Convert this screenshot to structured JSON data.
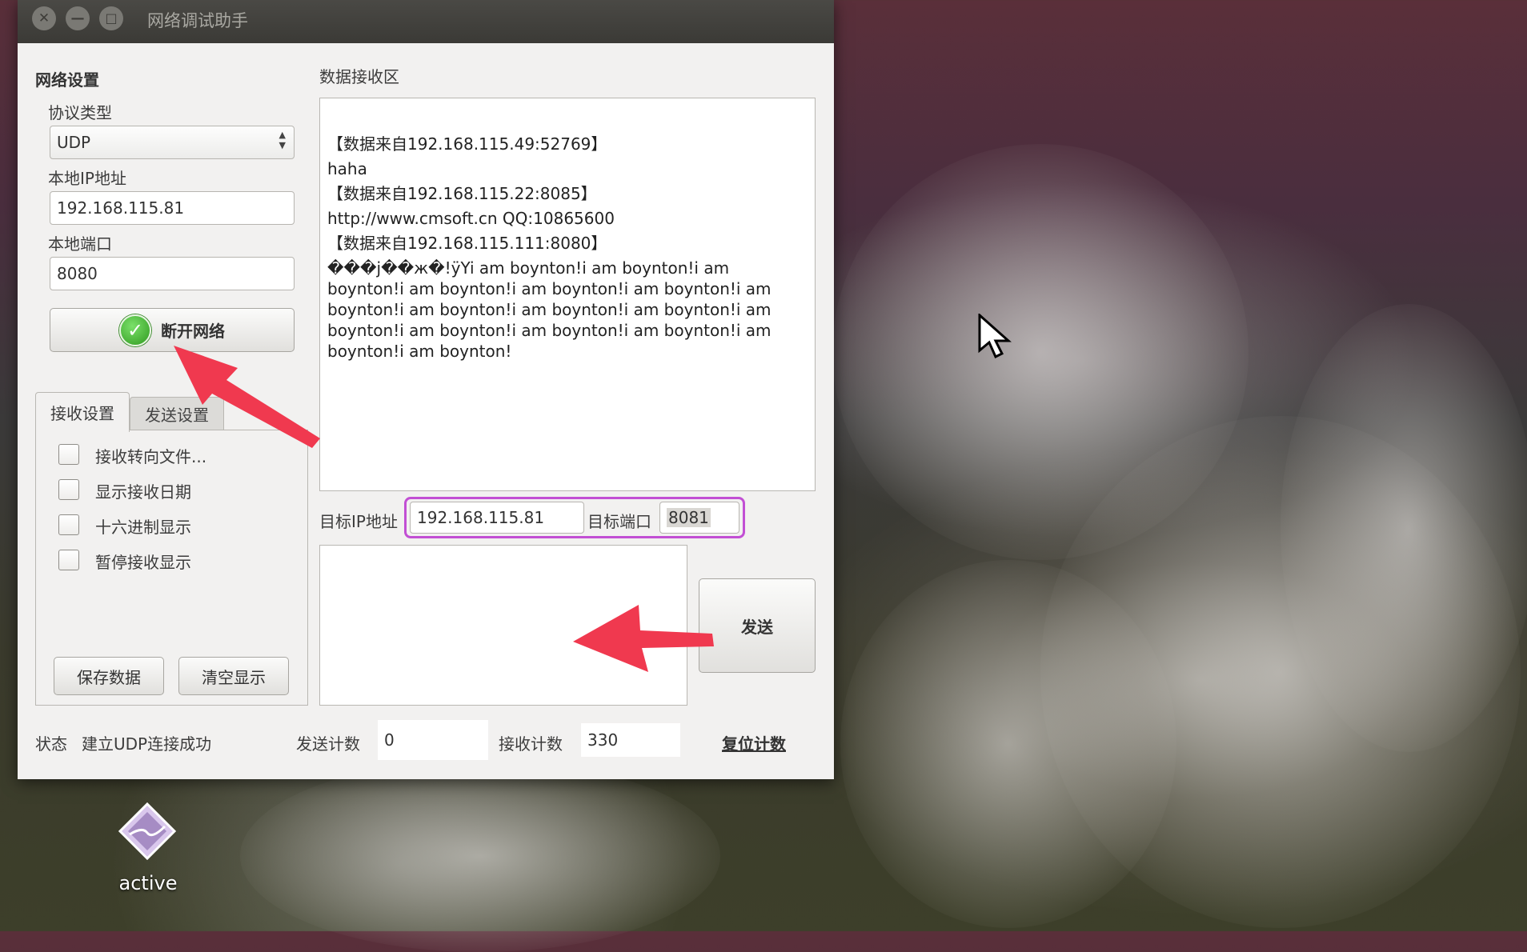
{
  "window": {
    "title": "网络调试助手",
    "close_glyph": "✕",
    "minimize_glyph": "—",
    "maximize_glyph": "□"
  },
  "network_settings": {
    "heading": "网络设置",
    "protocol_label": "协议类型",
    "protocol_value": "UDP",
    "local_ip_label": "本地IP地址",
    "local_ip_value": "192.168.115.81",
    "local_port_label": "本地端口",
    "local_port_value": "8080",
    "connect_button_label": "断开网络"
  },
  "tabs": [
    {
      "label": "接收设置",
      "active": true
    },
    {
      "label": "发送设置",
      "active": false
    }
  ],
  "receive_settings": {
    "options": [
      {
        "label": "接收转向文件...",
        "checked": false
      },
      {
        "label": "显示接收日期",
        "checked": false
      },
      {
        "label": "十六进制显示",
        "checked": false
      },
      {
        "label": "暂停接收显示",
        "checked": false
      }
    ],
    "save_button_label": "保存数据",
    "clear_button_label": "清空显示"
  },
  "receive_area": {
    "heading": "数据接收区",
    "lines": [
      "【数据来自192.168.115.49:52769】",
      "haha",
      "【数据来自192.168.115.22:8085】",
      "http://www.cmsoft.cn QQ:10865600",
      "【数据来自192.168.115.111:8080】"
    ],
    "garbled_text": "���j��ж�!ÿYi am boynton!i am boynton!i am boynton!i am boynton!i am boynton!i am boynton!i am boynton!i am boynton!i am boynton!i am boynton!i am boynton!i am boynton!i am boynton!i am boynton!i am boynton!i am boynton!"
  },
  "target": {
    "ip_label": "目标IP地址",
    "ip_value": "192.168.115.81",
    "port_label": "目标端口",
    "port_value": "8081"
  },
  "send": {
    "button_label": "发送",
    "text_value": ""
  },
  "status_bar": {
    "status_label": "状态",
    "status_text": "建立UDP连接成功",
    "send_count_label": "发送计数",
    "send_count_value": "0",
    "recv_count_label": "接收计数",
    "recv_count_value": "330",
    "reset_button_label": "复位计数"
  },
  "desktop": {
    "icon_label": "active",
    "icon_name": "active-app-icon"
  },
  "colors": {
    "annotation_arrow": "#f0394f",
    "highlight_border": "#c24fd4",
    "connect_icon": "#3fb02c"
  }
}
